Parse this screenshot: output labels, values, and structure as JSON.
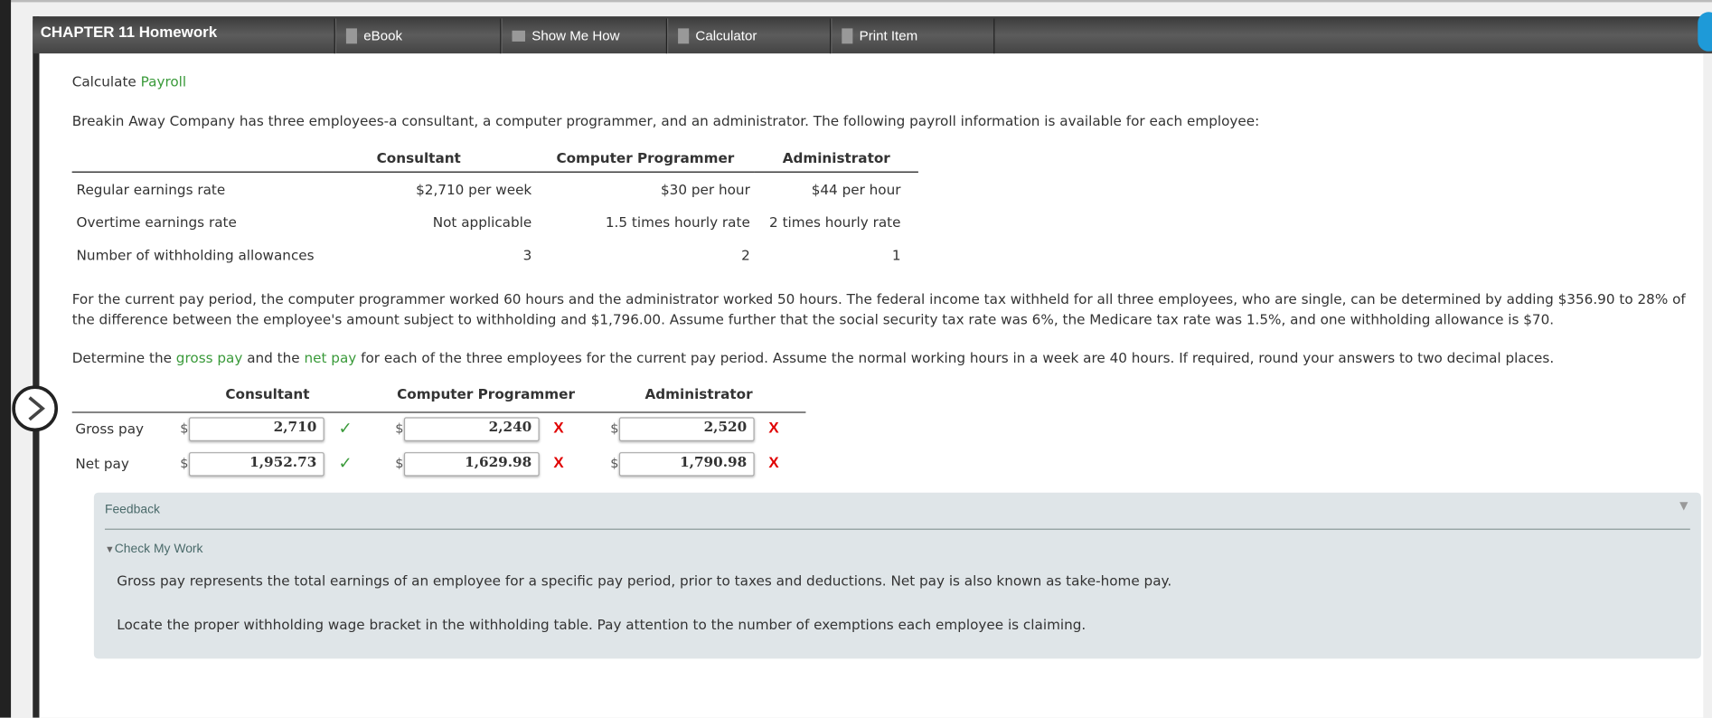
{
  "header": {
    "title": "CHAPTER 11 Homework",
    "buttons": [
      {
        "label": "eBook",
        "icon": "book-icon"
      },
      {
        "label": "Show Me How",
        "icon": "video-icon"
      },
      {
        "label": "Calculator",
        "icon": "calculator-icon"
      },
      {
        "label": "Print Item",
        "icon": "print-icon"
      }
    ]
  },
  "problem": {
    "title_prefix": "Calculate",
    "title_link": "Payroll",
    "intro": "Breakin Away Company has three employees-a consultant, a computer programmer, and an administrator. The following payroll information is available for each employee:",
    "table": {
      "headers": [
        "",
        "Consultant",
        "Computer Programmer",
        "Administrator"
      ],
      "rows": [
        [
          "Regular earnings rate",
          "$2,710 per week",
          "$30 per hour",
          "$44 per hour"
        ],
        [
          "Overtime earnings rate",
          "Not applicable",
          "1.5 times hourly rate",
          "2 times hourly rate"
        ],
        [
          "Number of withholding allowances",
          "3",
          "2",
          "1"
        ]
      ]
    },
    "para2": "For the current pay period, the computer programmer worked 60 hours and the administrator worked 50 hours. The federal income tax withheld for all three employees, who are single, can be determined by adding $356.90 to 28% of the difference between the employee's amount subject to withholding and $1,796.00. Assume further that the social security tax rate was 6%, the Medicare tax rate was 1.5%, and one withholding allowance is $70.",
    "instr_1": "Determine the",
    "instr_gross": "gross pay",
    "instr_2": "and the",
    "instr_net": "net pay",
    "instr_3": "for each of the three employees for the current pay period. Assume the normal working hours in a week are 40 hours. If required, round your answers to two decimal places."
  },
  "answers": {
    "headers": [
      "Consultant",
      "Computer Programmer",
      "Administrator"
    ],
    "currency": "$",
    "rows": [
      {
        "label": "Gross pay",
        "values": [
          "2,710",
          "2,240",
          "2,520"
        ],
        "status": [
          "correct",
          "incorrect",
          "incorrect"
        ]
      },
      {
        "label": "Net pay",
        "values": [
          "1,952.73",
          "1,629.98",
          "1,790.98"
        ],
        "status": [
          "correct",
          "incorrect",
          "incorrect"
        ]
      }
    ],
    "correct_mark": "✓",
    "incorrect_mark": "X",
    "colors": {
      "correct": "#3a9a3a",
      "incorrect": "#e00000"
    }
  },
  "feedback": {
    "title": "Feedback",
    "toggle": "▼",
    "section": "Check My Work",
    "lines": [
      "Gross pay represents the total earnings of an employee for a specific pay period, prior to taxes and deductions. Net pay is also known as take-home pay.",
      "Locate the proper withholding wage bracket in the withholding table. Pay attention to the number of exemptions each employee is claiming."
    ]
  }
}
